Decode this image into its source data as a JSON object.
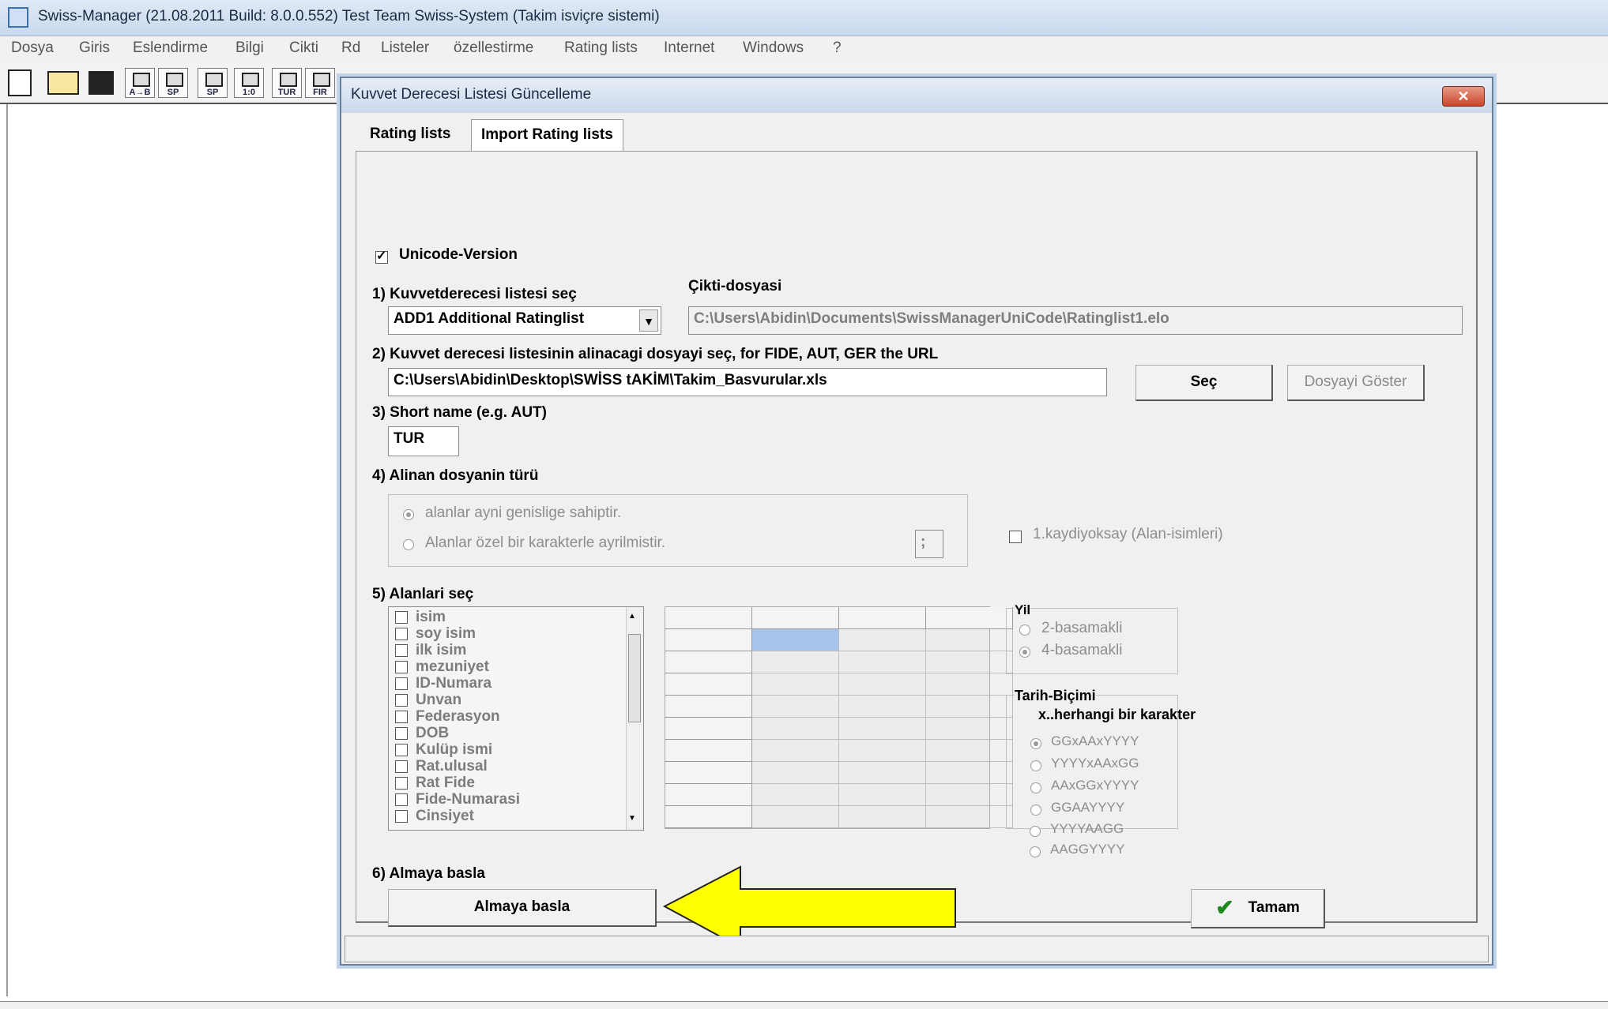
{
  "window": {
    "title": "Swiss-Manager (21.08.2011 Build: 8.0.0.552)  Test Team Swiss-System    (Takim isviçre sistemi)"
  },
  "menu": [
    "Dosya",
    "Giris",
    "Eslendirme",
    "Bilgi",
    "Cikti",
    "Rd",
    "Listeler",
    "özellestirme",
    "Rating lists",
    "Internet",
    "Windows",
    "?"
  ],
  "toolbar": [
    "A→B",
    "SP",
    "SP",
    "1:0",
    "TUR",
    "FIR"
  ],
  "dialog": {
    "title": "Kuvvet Derecesi Listesi Güncelleme",
    "close_label": "✕",
    "tabs": [
      "Rating lists",
      "Import Rating lists"
    ],
    "unicode_label": "Unicode-Version",
    "step1_label": "1) Kuvvetderecesi listesi seç",
    "ratinglist_value": "ADD1 Additional Ratinglist",
    "output_label": "Çikti-dosyasi",
    "output_value": "C:\\Users\\Abidin\\Documents\\SwissManagerUniCode\\Ratinglist1.elo",
    "step2_label": "2) Kuvvet derecesi listesinin alinacagi dosyayi seç, for FIDE, AUT, GER the URL",
    "file_value": "C:\\Users\\Abidin\\Desktop\\SWİSS tAKİM\\Takim_Basvurular.xls",
    "sec_button": "Seç",
    "show_file_button": "Dosyayi Göster",
    "step3_label": "3) Short name (e.g. AUT)",
    "short_name_value": "TUR",
    "step4_label": "4) Alinan dosyanin türü",
    "filetype_fixed": "alanlar ayni genislige sahiptir.",
    "filetype_delimited": "Alanlar özel bir karakterle ayrilmistir.",
    "delimiter_value": ";",
    "ignore_first_label": "1.kaydiyoksay (Alan-isimleri)",
    "step5_label": "5) Alanlari seç",
    "fields": [
      "isim",
      "soy isim",
      "ilk isim",
      "mezuniyet",
      "ID-Numara",
      "Unvan",
      "Federasyon",
      "DOB",
      "Kulüp ismi",
      "Rat.ulusal",
      "Rat Fide",
      "Fide-Numarasi",
      "Cinsiyet"
    ],
    "year_group_label": "Yil",
    "year_2": "2-basamakli",
    "year_4": "4-basamakli",
    "date_group_label": "Tarih-Biçimi",
    "date_hint": "x..herhangi bir karakter",
    "date_formats": [
      "GGxAAxYYYY",
      "YYYYxAAxGG",
      "AAxGGxYYYY",
      "GGAAYYYY",
      "YYYYAAGG",
      "AAGGYYYY"
    ],
    "step6_label": "6) Almaya basla",
    "start_button": "Almaya basla",
    "ok_button": "Tamam"
  },
  "colors": {
    "arrow": "#ffff00",
    "grid_selected": "#a9c4ea",
    "ok_check": "#1e8a1e"
  }
}
